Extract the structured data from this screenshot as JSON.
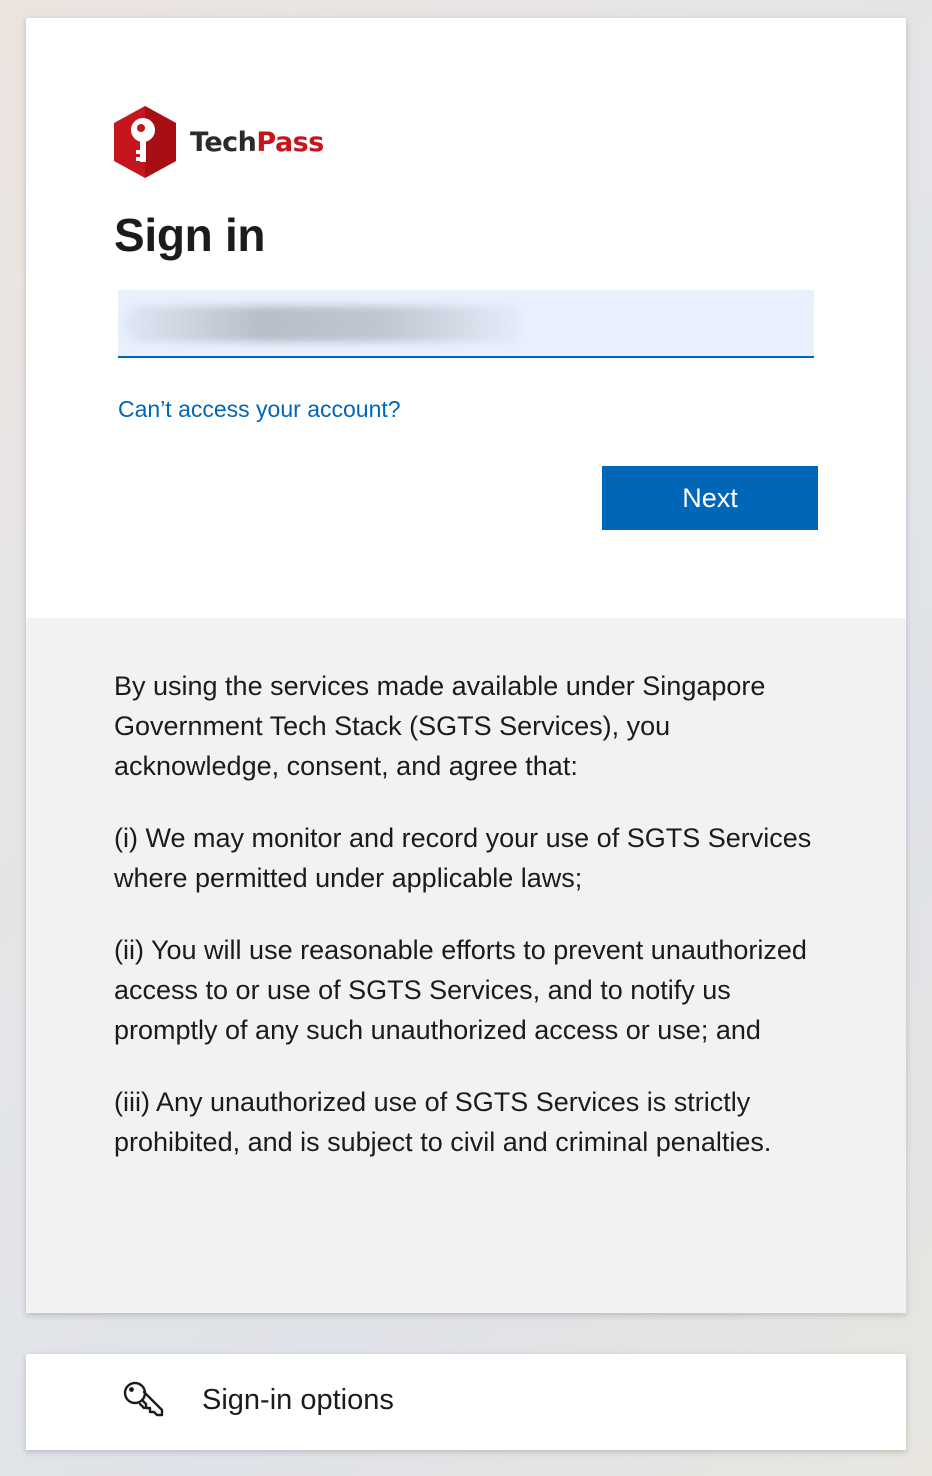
{
  "brand": {
    "name_part1": "Tech",
    "name_part2": "Pass",
    "primary_color": "#c4161c"
  },
  "signin": {
    "title": "Sign in",
    "email_value": "",
    "cant_access_link": "Can’t access your account?",
    "next_button": "Next",
    "accent_color": "#0067b8"
  },
  "notice": {
    "paragraphs": [
      "By using the services made available under Singapore Government Tech Stack (SGTS Services), you acknowledge, consent, and agree that:",
      "(i) We may monitor and record your use of SGTS Services where permitted under applicable laws;",
      "(ii) You will use reasonable efforts to prevent unauthorized access to or use of SGTS Services, and to notify us promptly of any such unauthorized access or use; and",
      "(iii) Any unauthorized use of SGTS Services is strictly prohibited, and is subject to civil and criminal penalties."
    ]
  },
  "options": {
    "label": "Sign-in options",
    "icon": "key-icon"
  }
}
